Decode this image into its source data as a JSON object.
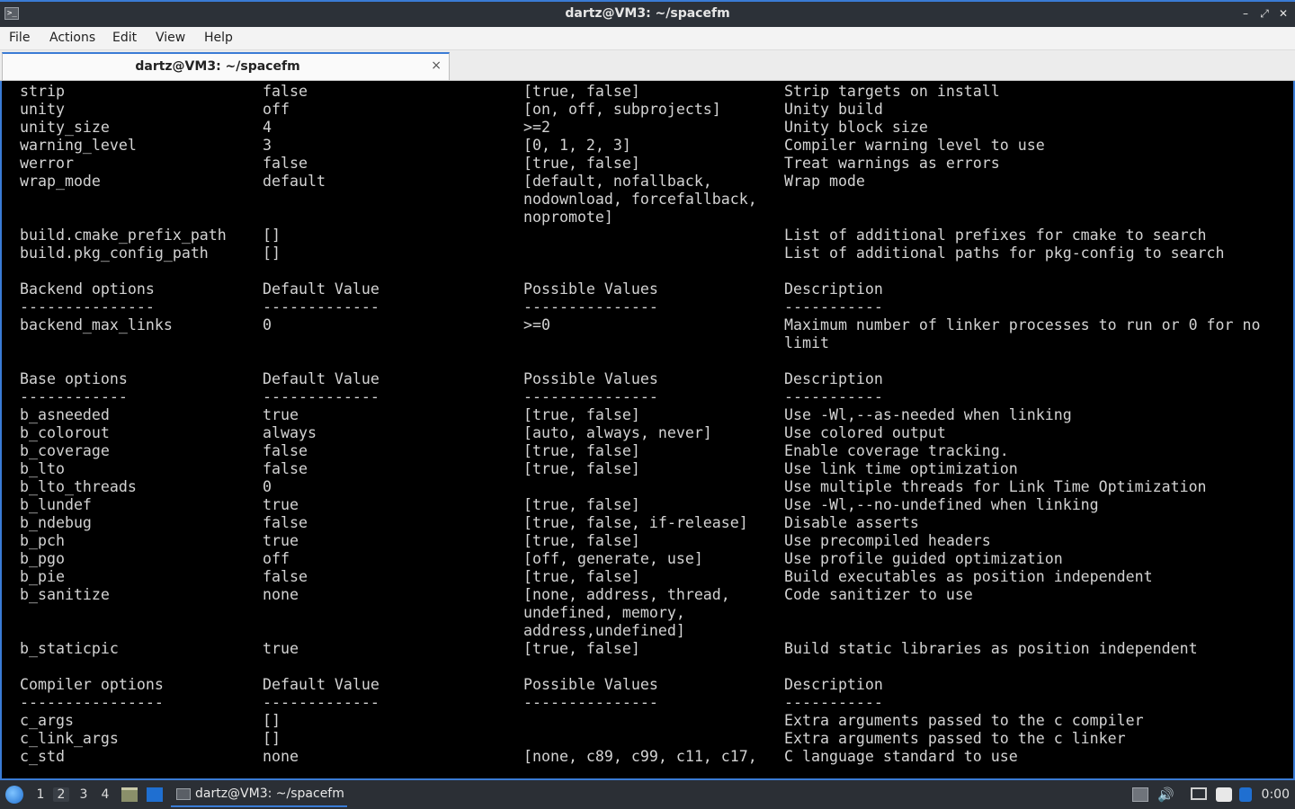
{
  "window": {
    "title": "dartz@VM3: ~/spacefm",
    "minimize": "–",
    "maximize": "⤢",
    "close": "✕"
  },
  "menu": [
    "File",
    "Actions",
    "Edit",
    "View",
    "Help"
  ],
  "tab": {
    "label": "dartz@VM3: ~/spacefm",
    "close": "×"
  },
  "terminal": {
    "lines": [
      [
        "strip",
        "false",
        "[true, false]",
        "Strip targets on install"
      ],
      [
        "unity",
        "off",
        "[on, off, subprojects]",
        "Unity build"
      ],
      [
        "unity_size",
        "4",
        ">=2",
        "Unity block size"
      ],
      [
        "warning_level",
        "3",
        "[0, 1, 2, 3]",
        "Compiler warning level to use"
      ],
      [
        "werror",
        "false",
        "[true, false]",
        "Treat warnings as errors"
      ],
      [
        "wrap_mode",
        "default",
        "[default, nofallback,",
        "Wrap mode"
      ],
      [
        "",
        "",
        "nodownload, forcefallback,",
        ""
      ],
      [
        "",
        "",
        "nopromote]",
        ""
      ],
      [
        "build.cmake_prefix_path",
        "[]",
        "",
        "List of additional prefixes for cmake to search"
      ],
      [
        "build.pkg_config_path",
        "[]",
        "",
        "List of additional paths for pkg-config to search"
      ],
      [
        "",
        "",
        "",
        ""
      ],
      [
        "Backend options",
        "Default Value",
        "Possible Values",
        "Description"
      ],
      [
        "---------------",
        "-------------",
        "---------------",
        "-----------"
      ],
      [
        "backend_max_links",
        "0",
        ">=0",
        "Maximum number of linker processes to run or 0 for no"
      ],
      [
        "",
        "",
        "",
        "limit"
      ],
      [
        "",
        "",
        "",
        ""
      ],
      [
        "Base options",
        "Default Value",
        "Possible Values",
        "Description"
      ],
      [
        "------------",
        "-------------",
        "---------------",
        "-----------"
      ],
      [
        "b_asneeded",
        "true",
        "[true, false]",
        "Use -Wl,--as-needed when linking"
      ],
      [
        "b_colorout",
        "always",
        "[auto, always, never]",
        "Use colored output"
      ],
      [
        "b_coverage",
        "false",
        "[true, false]",
        "Enable coverage tracking."
      ],
      [
        "b_lto",
        "false",
        "[true, false]",
        "Use link time optimization"
      ],
      [
        "b_lto_threads",
        "0",
        "",
        "Use multiple threads for Link Time Optimization"
      ],
      [
        "b_lundef",
        "true",
        "[true, false]",
        "Use -Wl,--no-undefined when linking"
      ],
      [
        "b_ndebug",
        "false",
        "[true, false, if-release]",
        "Disable asserts"
      ],
      [
        "b_pch",
        "true",
        "[true, false]",
        "Use precompiled headers"
      ],
      [
        "b_pgo",
        "off",
        "[off, generate, use]",
        "Use profile guided optimization"
      ],
      [
        "b_pie",
        "false",
        "[true, false]",
        "Build executables as position independent"
      ],
      [
        "b_sanitize",
        "none",
        "[none, address, thread,",
        "Code sanitizer to use"
      ],
      [
        "",
        "",
        "undefined, memory,",
        ""
      ],
      [
        "",
        "",
        "address,undefined]",
        ""
      ],
      [
        "b_staticpic",
        "true",
        "[true, false]",
        "Build static libraries as position independent"
      ],
      [
        "",
        "",
        "",
        ""
      ],
      [
        "Compiler options",
        "Default Value",
        "Possible Values",
        "Description"
      ],
      [
        "----------------",
        "-------------",
        "---------------",
        "-----------"
      ],
      [
        "c_args",
        "[]",
        "",
        "Extra arguments passed to the c compiler"
      ],
      [
        "c_link_args",
        "[]",
        "",
        "Extra arguments passed to the c linker"
      ],
      [
        "c_std",
        "none",
        "[none, c89, c99, c11, c17,",
        "C language standard to use"
      ]
    ]
  },
  "taskbar": {
    "workspaces": [
      "1",
      "2",
      "3",
      "4"
    ],
    "active_workspace": "2",
    "task_label": "dartz@VM3: ~/spacefm",
    "clock": "0:00"
  }
}
